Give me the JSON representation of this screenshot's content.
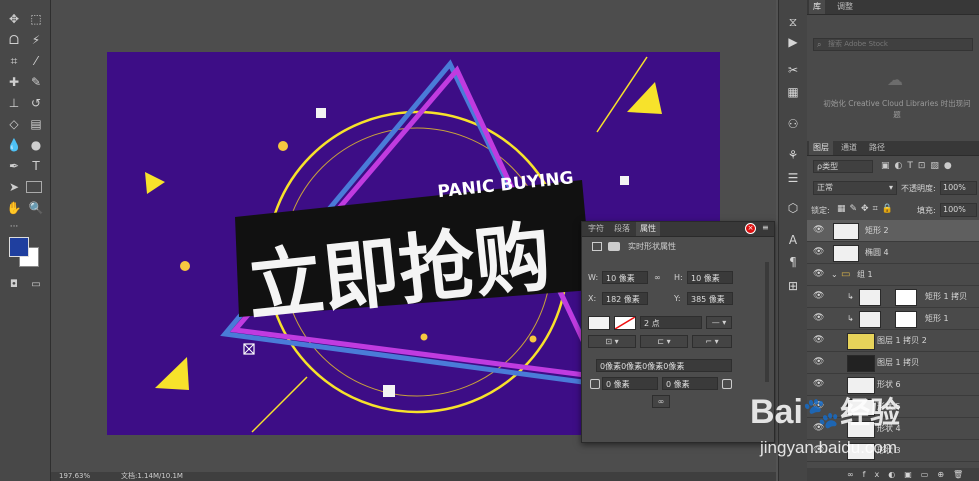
{
  "canvas": {
    "art": {
      "headline": "立即抢购",
      "subheadline": "PANIC BUYING"
    }
  },
  "status_bar": {
    "zoom": "197.63%",
    "doc_info": "文档:1.14M/10.1M"
  },
  "library_panel": {
    "tabs": [
      "库",
      "调整"
    ],
    "search_placeholder": "搜索 Adobe Stock",
    "message": "初始化 Creative Cloud Libraries 时出现问题"
  },
  "layers_panel": {
    "tabs": [
      "图层",
      "通道",
      "路径"
    ],
    "filter_label": "ρ类型",
    "blend_mode": "正常",
    "opacity_label": "不透明度:",
    "opacity_value": "100%",
    "lock_label": "锁定:",
    "fill_label": "填充:",
    "fill_value": "100%",
    "layers": [
      {
        "name": "矩形 2",
        "selected": true
      },
      {
        "name": "椭圆 4"
      },
      {
        "name": "组 1"
      },
      {
        "name": "矩形 1 拷贝"
      },
      {
        "name": "矩形 1"
      },
      {
        "name": "图层 1 拷贝 2"
      },
      {
        "name": "图层 1 拷贝"
      },
      {
        "name": "形状 6"
      },
      {
        "name": "形状 5"
      },
      {
        "name": "形状 4"
      },
      {
        "name": "形状 3"
      }
    ]
  },
  "properties_panel": {
    "tabs": [
      "字符",
      "段落",
      "属性"
    ],
    "title": "实时形状属性",
    "w_label": "W:",
    "w_value": "10 像素",
    "h_label": "H:",
    "h_value": "10 像素",
    "x_label": "X:",
    "x_value": "182 像素",
    "y_label": "Y:",
    "y_value": "385 像素",
    "stroke_width": "2 点",
    "corner_summary": "0像素0像素0像素0像素",
    "corner_a": "0 像素",
    "corner_b": "0 像素"
  },
  "watermark": {
    "brand": "Bai",
    "brand_cn": "经验",
    "url": "jingyan.baidu.com"
  },
  "colors": {
    "artboard_bg": "#3d0d86",
    "accent_yellow": "#f7e22b",
    "accent_magenta": "#c03be0",
    "accent_blue": "#4a7bd8",
    "foreground_swatch": "#1f3f9f"
  }
}
